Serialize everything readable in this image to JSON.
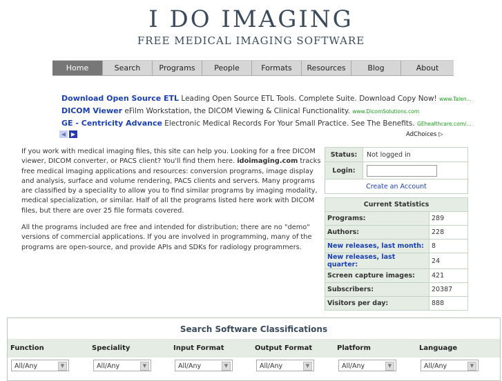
{
  "header": {
    "title": "I DO IMAGING",
    "subtitle": "FREE MEDICAL IMAGING SOFTWARE"
  },
  "nav": [
    {
      "label": "Home",
      "active": true
    },
    {
      "label": "Search"
    },
    {
      "label": "Programs"
    },
    {
      "label": "People"
    },
    {
      "label": "Formats"
    },
    {
      "label": "Resources"
    },
    {
      "label": "Blog"
    },
    {
      "label": "About"
    }
  ],
  "ads": [
    {
      "title": "Download Open Source ETL",
      "text": " Leading Open Source ETL Tools. Complete Suite. Download Copy Now! ",
      "url": "www.Talen..."
    },
    {
      "title": "DICOM Viewer",
      "text": " eFilm Workstation, the DICOM Viewing & Clinical Functionality. ",
      "url": "www.DicomSolutions.com"
    },
    {
      "title": "GE - Centricity Advance",
      "text": " Electronic Medical Records For Your Small Practice. See The Benefits. ",
      "url": "GEhealthcare.com/..."
    }
  ],
  "adchoices": "AdChoices ▷",
  "intro": {
    "p1_a": "If you work with medical imaging files, this site can help you. Looking for a free DICOM viewer, DICOM converter, or PACS client? You'll find them here. ",
    "p1_bold": "idoimaging.com",
    "p1_b": " tracks free medical imaging applications and resources: conversion programs, image display and analysis, surface and volume rendering, PACS clients and servers. Many programs are classified by a speciality to allow you to find similar programs by imaging modality, medical specialization, or similar. Half of all the programs listed here work with DICOM files, but there are over 25 file formats covered.",
    "p2": "All the programs included are free and intended for distribution; there are no \"demo\" versions of commercial applications. If you are involved in programming, many of the programs are open-source, and provide APIs and SDKs for radiology programmers."
  },
  "login": {
    "status_label": "Status:",
    "status_value": "Not logged in",
    "login_label": "Login:",
    "create_account": "Create an Account"
  },
  "stats": {
    "title": "Current Statistics",
    "rows": [
      {
        "label": "Programs:",
        "value": "289",
        "link": false
      },
      {
        "label": "Authors:",
        "value": "228",
        "link": false
      },
      {
        "label": "New releases, last month:",
        "value": "8",
        "link": true
      },
      {
        "label": "New releases, last quarter:",
        "value": "24",
        "link": true
      },
      {
        "label": "Screen capture images:",
        "value": "421",
        "link": false
      },
      {
        "label": "Subscribers:",
        "value": "20387",
        "link": false
      },
      {
        "label": "Visitors per day:",
        "value": "888",
        "link": false
      }
    ]
  },
  "search": {
    "title": "Search Software Classifications",
    "columns": [
      "Function",
      "Speciality",
      "Input Format",
      "Output Format",
      "Platform",
      "Language"
    ],
    "selected": [
      "All/Any",
      "All/Any",
      "All/Any",
      "All/Any",
      "All/Any",
      "All/Any"
    ]
  },
  "colors": {
    "link": "#1a3fb3",
    "ad_url": "#18a018",
    "nav_active": "#777777",
    "panel_bg": "#e4ece4"
  }
}
